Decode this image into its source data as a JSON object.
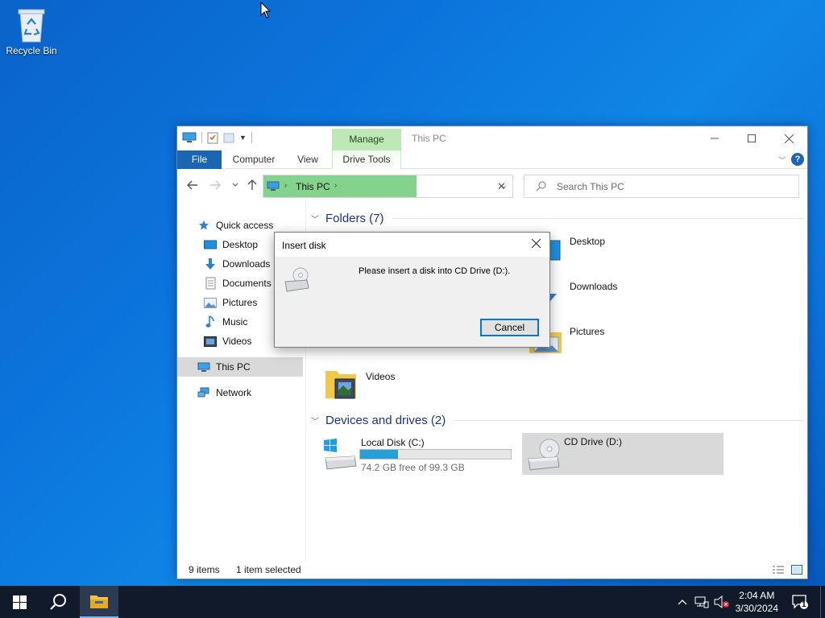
{
  "desktop": {
    "recycle_bin_label": "Recycle Bin"
  },
  "explorer": {
    "title": "This PC",
    "contextual_tab_group": "Manage",
    "ribbon_tabs": [
      "File",
      "Computer",
      "View",
      "Drive Tools"
    ],
    "address": {
      "location": "This PC"
    },
    "search": {
      "placeholder": "Search This PC"
    },
    "nav": {
      "quick_access": "Quick access",
      "items": [
        "Desktop",
        "Downloads",
        "Documents",
        "Pictures",
        "Music",
        "Videos"
      ],
      "this_pc": "This PC",
      "network": "Network"
    },
    "folders_group": {
      "header": "Folders (7)",
      "items": [
        "Desktop",
        "Downloads",
        "Pictures",
        "Videos"
      ]
    },
    "devices_group": {
      "header": "Devices and drives (2)",
      "drives": [
        {
          "name": "Local Disk (C:)",
          "free_text": "74.2 GB free of 99.3 GB",
          "used_fraction": 0.253
        },
        {
          "name": "CD Drive (D:)"
        }
      ]
    },
    "status": {
      "items": "9 items",
      "selected": "1 item selected"
    }
  },
  "dialog": {
    "title": "Insert disk",
    "message": "Please insert a disk into CD Drive (D:).",
    "cancel": "Cancel"
  },
  "taskbar": {
    "time": "2:04 AM",
    "date": "3/30/2024",
    "notification_count": "1"
  },
  "colors": {
    "accent": "#0078d7",
    "address_highlight": "#83d38c",
    "manage_tab": "#bfe8b6",
    "taskbar": "#101a2b"
  }
}
